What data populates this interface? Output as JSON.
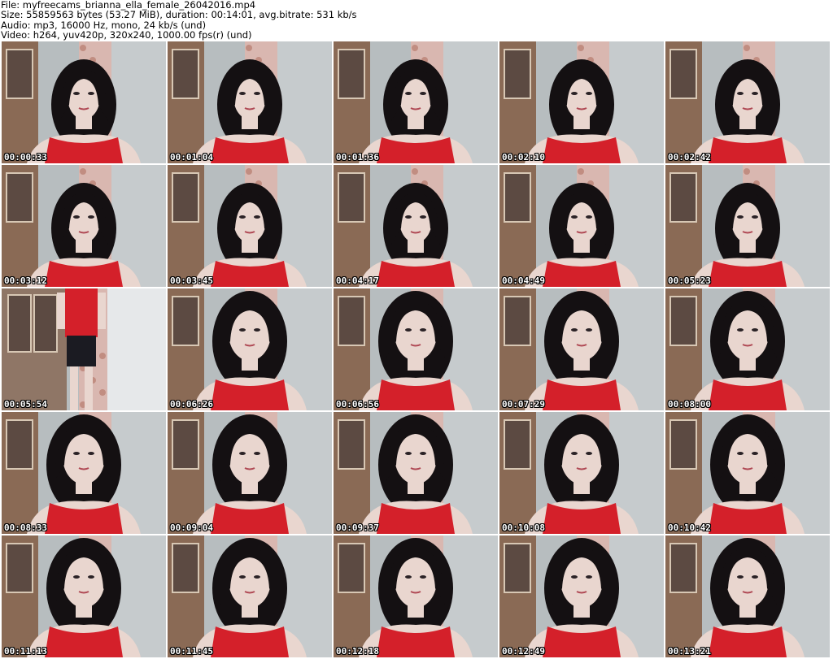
{
  "header": {
    "file_line": "File: myfreecams_brianna_ella_female_26042016.mp4",
    "size_line": "Size: 55859563 bytes (53.27 MiB), duration: 00:14:01, avg.bitrate: 531 kb/s",
    "audio_line": "Audio: mp3, 16000 Hz, mono, 24 kb/s (und)",
    "video_line": "Video: h264, yuv420p, 320x240, 1000.00 fps(r) (und)"
  },
  "thumbnails": [
    {
      "time": "00:00:33",
      "scene": "closeup"
    },
    {
      "time": "00:01:04",
      "scene": "closeup"
    },
    {
      "time": "00:01:36",
      "scene": "closeup"
    },
    {
      "time": "00:02:10",
      "scene": "closeup"
    },
    {
      "time": "00:02:42",
      "scene": "closeup"
    },
    {
      "time": "00:03:12",
      "scene": "closeup"
    },
    {
      "time": "00:03:45",
      "scene": "closeup"
    },
    {
      "time": "00:04:17",
      "scene": "closeup"
    },
    {
      "time": "00:04:49",
      "scene": "closeup"
    },
    {
      "time": "00:05:23",
      "scene": "closeup"
    },
    {
      "time": "00:05:54",
      "scene": "standing"
    },
    {
      "time": "00:06:26",
      "scene": "near"
    },
    {
      "time": "00:06:56",
      "scene": "near"
    },
    {
      "time": "00:07:29",
      "scene": "near"
    },
    {
      "time": "00:08:00",
      "scene": "near"
    },
    {
      "time": "00:08:33",
      "scene": "near"
    },
    {
      "time": "00:09:04",
      "scene": "near"
    },
    {
      "time": "00:09:37",
      "scene": "near"
    },
    {
      "time": "00:10:08",
      "scene": "near"
    },
    {
      "time": "00:10:42",
      "scene": "near"
    },
    {
      "time": "00:11:13",
      "scene": "near"
    },
    {
      "time": "00:11:45",
      "scene": "near"
    },
    {
      "time": "00:12:18",
      "scene": "near"
    },
    {
      "time": "00:12:49",
      "scene": "near"
    },
    {
      "time": "00:13:21",
      "scene": "near"
    }
  ],
  "colors": {
    "wall": "#b7bdbf",
    "shirt": "#d4202a",
    "hair": "#141012",
    "skin": "#e9d6cf",
    "cabinet": "#8a6a55",
    "floral": "#d9b7b0"
  }
}
